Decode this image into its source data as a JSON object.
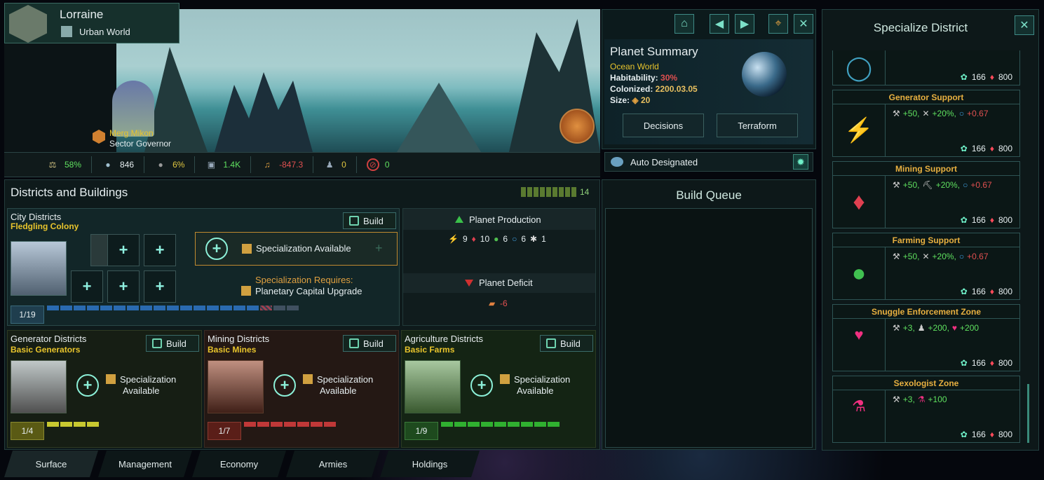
{
  "planet_header": {
    "name": "Lorraine",
    "type": "Urban World",
    "governor_name": "Merg Mikon",
    "governor_title": "Sector Governor"
  },
  "stats": [
    {
      "icon": "stability-icon",
      "value": "58%",
      "color": "#5fe05f"
    },
    {
      "icon": "pops-icon",
      "value": "846",
      "color": "#eef"
    },
    {
      "icon": "unemployed-icon",
      "value": "6%",
      "color": "#e0c640"
    },
    {
      "icon": "amenities-icon",
      "value": "1.4K",
      "color": "#5fe05f"
    },
    {
      "icon": "housing-icon",
      "value": "-847.3",
      "color": "#e05050"
    },
    {
      "icon": "crime-icon",
      "value": "0",
      "color": "#e0c640"
    },
    {
      "icon": "devastation-icon",
      "value": "0",
      "color": "#5fe05f"
    }
  ],
  "districts_section": {
    "title": "Districts and Buildings",
    "building_slots": "14"
  },
  "city": {
    "title": "City Districts",
    "subtitle": "Fledgling Colony",
    "build": "Build",
    "spec_available": "Specialization Available",
    "spec_requires": "Specialization Requires:",
    "spec_req_item": "Planetary Capital Upgrade",
    "count": "1/19"
  },
  "generator": {
    "title": "Generator Districts",
    "subtitle": "Basic Generators",
    "build": "Build",
    "spec": "Specialization",
    "spec2": "Available",
    "count": "1/4"
  },
  "mining": {
    "title": "Mining Districts",
    "subtitle": "Basic Mines",
    "build": "Build",
    "spec": "Specialization",
    "spec2": "Available",
    "count": "1/7"
  },
  "agri": {
    "title": "Agriculture Districts",
    "subtitle": "Basic Farms",
    "build": "Build",
    "spec": "Specialization",
    "spec2": "Available",
    "count": "1/9"
  },
  "production": {
    "title": "Planet Production",
    "items": [
      {
        "icon": "energy-icon",
        "v": "9"
      },
      {
        "icon": "minerals-icon",
        "v": "10"
      },
      {
        "icon": "food-icon",
        "v": "6"
      },
      {
        "icon": "alloys-icon",
        "v": "6"
      },
      {
        "icon": "research-icon",
        "v": "1"
      }
    ]
  },
  "deficit": {
    "title": "Planet Deficit",
    "value": "-6"
  },
  "summary": {
    "title": "Planet Summary",
    "world": "Ocean World",
    "hab_label": "Habitability:",
    "hab": "30%",
    "col_label": "Colonized:",
    "col": "2200.03.05",
    "size_label": "Size:",
    "size": "20",
    "decisions": "Decisions",
    "terraform": "Terraform"
  },
  "designation": "Auto Designated",
  "build_queue": "Build Queue",
  "specialize": {
    "title": "Specialize District",
    "cards": [
      {
        "name": "",
        "icon": "ring-icon",
        "effects": [],
        "cost_a": "166",
        "cost_b": "800"
      },
      {
        "name": "Generator Support",
        "icon": "generator-icon",
        "effects": [
          {
            "v": "+50,",
            "c": "#5fe05f"
          },
          {
            "v": "+20%,",
            "c": "#5fe05f"
          },
          {
            "v": "+0.67",
            "c": "#e05050"
          }
        ],
        "cost_a": "166",
        "cost_b": "800"
      },
      {
        "name": "Mining Support",
        "icon": "gem-icon",
        "effects": [
          {
            "v": "+50,",
            "c": "#5fe05f"
          },
          {
            "v": "+20%,",
            "c": "#5fe05f"
          },
          {
            "v": "+0.67",
            "c": "#e05050"
          }
        ],
        "cost_a": "166",
        "cost_b": "800"
      },
      {
        "name": "Farming Support",
        "icon": "apple-icon",
        "effects": [
          {
            "v": "+50,",
            "c": "#5fe05f"
          },
          {
            "v": "+20%,",
            "c": "#5fe05f"
          },
          {
            "v": "+0.67",
            "c": "#e05050"
          }
        ],
        "cost_a": "166",
        "cost_b": "800"
      },
      {
        "name": "Snuggle Enforcement Zone",
        "icon": "badge-icon",
        "effects": [
          {
            "v": "+3,",
            "c": "#5fe05f"
          },
          {
            "v": "+200,",
            "c": "#5fe05f"
          },
          {
            "v": "+200",
            "c": "#5fe05f"
          }
        ],
        "cost_a": "166",
        "cost_b": "800"
      },
      {
        "name": "Sexologist Zone",
        "icon": "flask-icon",
        "effects": [
          {
            "v": "+3,",
            "c": "#5fe05f"
          },
          {
            "v": "+100",
            "c": "#5fe05f"
          }
        ],
        "cost_a": "166",
        "cost_b": "800"
      }
    ]
  },
  "tabs": [
    "Surface",
    "Management",
    "Economy",
    "Armies",
    "Holdings"
  ]
}
